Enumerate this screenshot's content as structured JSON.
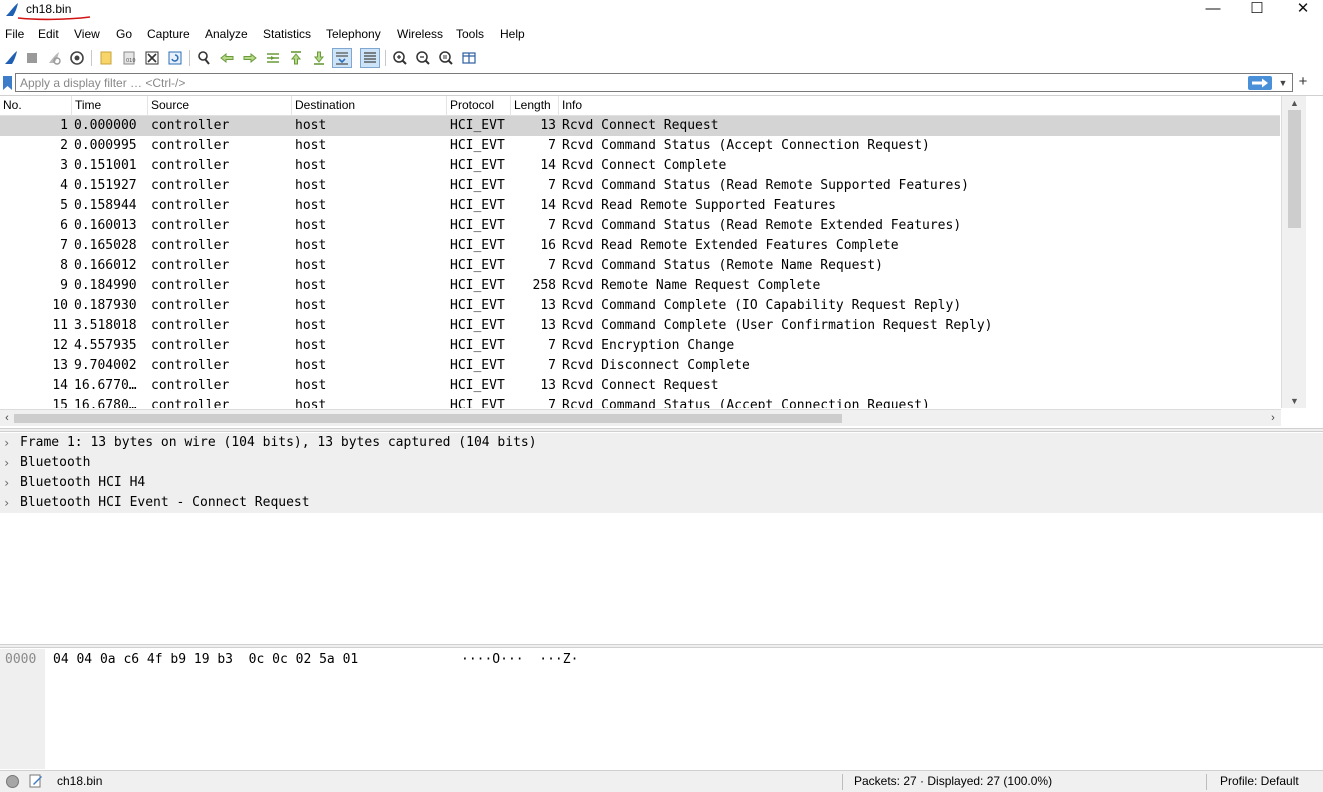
{
  "window": {
    "title": "ch18.bin",
    "minimize_glyph": "—",
    "maximize_glyph": "☐",
    "close_glyph": "✕"
  },
  "menu": [
    "File",
    "Edit",
    "View",
    "Go",
    "Capture",
    "Analyze",
    "Statistics",
    "Telephony",
    "Wireless",
    "Tools",
    "Help"
  ],
  "toolbar": {
    "icons": [
      "shark-fin-start-icon",
      "stop-capture-icon",
      "restart-capture-icon",
      "capture-options-icon",
      "open-file-icon",
      "save-file-icon",
      "close-file-icon",
      "reload-file-icon",
      "find-packet-icon",
      "go-back-icon",
      "go-forward-icon",
      "go-to-packet-icon",
      "go-first-icon",
      "go-last-icon",
      "auto-scroll-icon",
      "colorize-icon",
      "zoom-in-icon",
      "zoom-out-icon",
      "zoom-normal-icon",
      "resize-columns-icon"
    ]
  },
  "filter": {
    "placeholder": "Apply a display filter … <Ctrl-/>",
    "value": ""
  },
  "packet_list": {
    "columns": [
      "No.",
      "Time",
      "Source",
      "Destination",
      "Protocol",
      "Length",
      "Info"
    ],
    "rows": [
      {
        "no": "1",
        "time": "0.000000",
        "source": "controller",
        "destination": "host",
        "protocol": "HCI_EVT",
        "length": "13",
        "info": "Rcvd Connect Request"
      },
      {
        "no": "2",
        "time": "0.000995",
        "source": "controller",
        "destination": "host",
        "protocol": "HCI_EVT",
        "length": "7",
        "info": "Rcvd Command Status (Accept Connection Request)"
      },
      {
        "no": "3",
        "time": "0.151001",
        "source": "controller",
        "destination": "host",
        "protocol": "HCI_EVT",
        "length": "14",
        "info": "Rcvd Connect Complete"
      },
      {
        "no": "4",
        "time": "0.151927",
        "source": "controller",
        "destination": "host",
        "protocol": "HCI_EVT",
        "length": "7",
        "info": "Rcvd Command Status (Read Remote Supported Features)"
      },
      {
        "no": "5",
        "time": "0.158944",
        "source": "controller",
        "destination": "host",
        "protocol": "HCI_EVT",
        "length": "14",
        "info": "Rcvd Read Remote Supported Features"
      },
      {
        "no": "6",
        "time": "0.160013",
        "source": "controller",
        "destination": "host",
        "protocol": "HCI_EVT",
        "length": "7",
        "info": "Rcvd Command Status (Read Remote Extended Features)"
      },
      {
        "no": "7",
        "time": "0.165028",
        "source": "controller",
        "destination": "host",
        "protocol": "HCI_EVT",
        "length": "16",
        "info": "Rcvd Read Remote Extended Features Complete"
      },
      {
        "no": "8",
        "time": "0.166012",
        "source": "controller",
        "destination": "host",
        "protocol": "HCI_EVT",
        "length": "7",
        "info": "Rcvd Command Status (Remote Name Request)"
      },
      {
        "no": "9",
        "time": "0.184990",
        "source": "controller",
        "destination": "host",
        "protocol": "HCI_EVT",
        "length": "258",
        "info": "Rcvd Remote Name Request Complete"
      },
      {
        "no": "10",
        "time": "0.187930",
        "source": "controller",
        "destination": "host",
        "protocol": "HCI_EVT",
        "length": "13",
        "info": "Rcvd Command Complete (IO Capability Request Reply)"
      },
      {
        "no": "11",
        "time": "3.518018",
        "source": "controller",
        "destination": "host",
        "protocol": "HCI_EVT",
        "length": "13",
        "info": "Rcvd Command Complete (User Confirmation Request Reply)"
      },
      {
        "no": "12",
        "time": "4.557935",
        "source": "controller",
        "destination": "host",
        "protocol": "HCI_EVT",
        "length": "7",
        "info": "Rcvd Encryption Change"
      },
      {
        "no": "13",
        "time": "9.704002",
        "source": "controller",
        "destination": "host",
        "protocol": "HCI_EVT",
        "length": "7",
        "info": "Rcvd Disconnect Complete"
      },
      {
        "no": "14",
        "time": "16.6770…",
        "source": "controller",
        "destination": "host",
        "protocol": "HCI_EVT",
        "length": "13",
        "info": "Rcvd Connect Request"
      },
      {
        "no": "15",
        "time": "16.6780…",
        "source": "controller",
        "destination": "host",
        "protocol": "HCI_EVT",
        "length": "7",
        "info": "Rcvd Command Status (Accept Connection Request)"
      }
    ],
    "selected_row": 0
  },
  "details": [
    {
      "text": "Frame 1: 13 bytes on wire (104 bits), 13 bytes captured (104 bits)"
    },
    {
      "text": "Bluetooth"
    },
    {
      "text": "Bluetooth HCI H4"
    },
    {
      "text": "Bluetooth HCI Event - Connect Request"
    }
  ],
  "bytes": {
    "offset": "0000",
    "hex": "04 04 0a c6 4f b9 19 b3  0c 0c 02 5a 01",
    "ascii": "····O···  ···Z·"
  },
  "status": {
    "file": "ch18.bin",
    "packets": "Packets: 27 · Displayed: 27 (100.0%)",
    "profile": "Profile: Default"
  },
  "colors": {
    "selected_row": "#d4d4d4",
    "detail_row": "#efefef",
    "shark_blue": "#1f5fb4",
    "annotation_red": "#d21414"
  }
}
